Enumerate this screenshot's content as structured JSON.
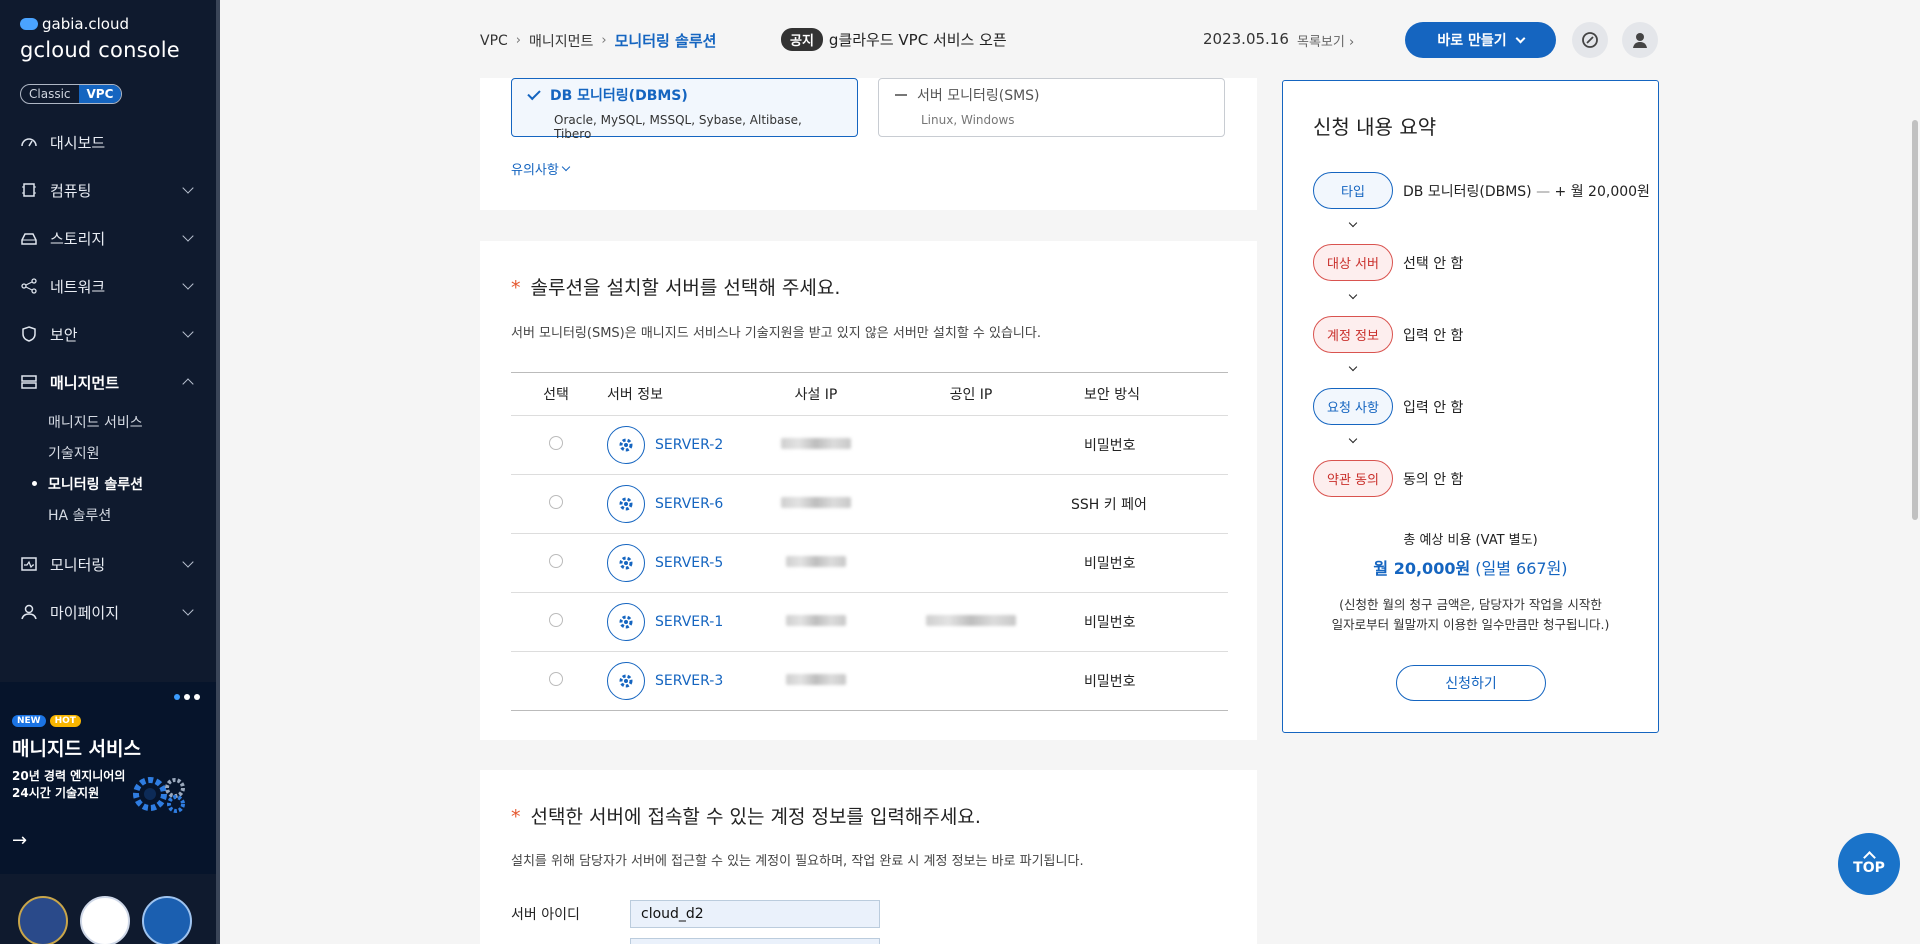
{
  "sidebar": {
    "logo_small": "gabia.cloud",
    "logo_big": "gcloud console",
    "toggle": {
      "classic": "Classic",
      "vpc": "VPC"
    },
    "items": [
      {
        "label": "대시보드",
        "icon": "dashboard-icon"
      },
      {
        "label": "컴퓨팅",
        "icon": "cpu-icon"
      },
      {
        "label": "스토리지",
        "icon": "storage-icon"
      },
      {
        "label": "네트워크",
        "icon": "network-icon"
      },
      {
        "label": "보안",
        "icon": "shield-icon"
      },
      {
        "label": "매니지먼트",
        "icon": "management-icon"
      },
      {
        "label": "모니터링",
        "icon": "monitor-icon"
      },
      {
        "label": "마이페이지",
        "icon": "user-icon"
      }
    ],
    "submenu": [
      "매니지드 서비스",
      "기술지원",
      "모니터링 솔루션",
      "HA 솔루션"
    ],
    "banner": {
      "badge_new": "NEW",
      "badge_hot": "HOT",
      "title": "매니지드 서비스",
      "subtitle": "20년 경력 엔지니어의 24시간 기술지원"
    }
  },
  "header": {
    "breadcrumb": [
      "VPC",
      "매니지먼트",
      "모니터링 솔루션"
    ],
    "notice_tag": "공지",
    "notice_text": "g클라우드 VPC 서비스 오픈",
    "date": "2023.05.16",
    "list_link": "목록보기",
    "make_button": "바로 만들기"
  },
  "types": {
    "dbms": {
      "title": "DB 모니터링(DBMS)",
      "sub": "Oracle, MySQL, MSSQL, Sybase, Altibase, Tibero"
    },
    "sms": {
      "title": "서버 모니터링(SMS)",
      "sub": "Linux, Windows"
    },
    "caution": "유의사항"
  },
  "servers_section": {
    "title": "솔루션을 설치할 서버를 선택해 주세요.",
    "desc": "서버 모니터링(SMS)은 매니지드 서비스나 기술지원을 받고 있지 않은 서버만 설치할 수 있습니다.",
    "headers": [
      "선택",
      "서버 정보",
      "사설 IP",
      "공인 IP",
      "보안 방식"
    ],
    "rows": [
      {
        "name": "SERVER-2",
        "security": "비밀번호"
      },
      {
        "name": "SERVER-6",
        "security": "SSH 키 페어"
      },
      {
        "name": "SERVER-5",
        "security": "비밀번호"
      },
      {
        "name": "SERVER-1",
        "security": "비밀번호"
      },
      {
        "name": "SERVER-3",
        "security": "비밀번호"
      }
    ]
  },
  "account_section": {
    "title": "선택한 서버에 접속할 수 있는 계정 정보를 입력해주세요.",
    "desc": "설치를 위해 담당자가 서버에 접근할 수 있는 계정이 필요하며, 작업 완료 시 계정 정보는 바로 파기됩니다.",
    "id_label": "서버 아이디",
    "id_value": "cloud_d2"
  },
  "summary": {
    "title": "신청 내용 요약",
    "steps": [
      {
        "pill": "타입",
        "value": "DB 모니터링(DBMS)",
        "extra": " — ",
        "price": "+ 월 20,000원"
      },
      {
        "pill": "대상 서버",
        "value": "선택 안 함"
      },
      {
        "pill": "계정 정보",
        "value": "입력 안 함"
      },
      {
        "pill": "요청 사항",
        "value": "입력 안 함"
      },
      {
        "pill": "약관 동의",
        "value": "동의 안 함"
      }
    ],
    "cost_label": "총 예상 비용 (VAT 별도)",
    "cost_monthly": "월 20,000원",
    "cost_daily": "(일별 667원)",
    "note_line1": "(신청한 월의 청구 금액은, 담당자가 작업을 시작한",
    "note_line2": "일자로부터 월말까지 이용한 일수만큼만 청구됩니다.)",
    "apply_button": "신청하기"
  },
  "top_button": "TOP",
  "colors": {
    "primary": "#1565c0",
    "sidebar": "#0f1a2e",
    "warning": "#d9534f"
  }
}
